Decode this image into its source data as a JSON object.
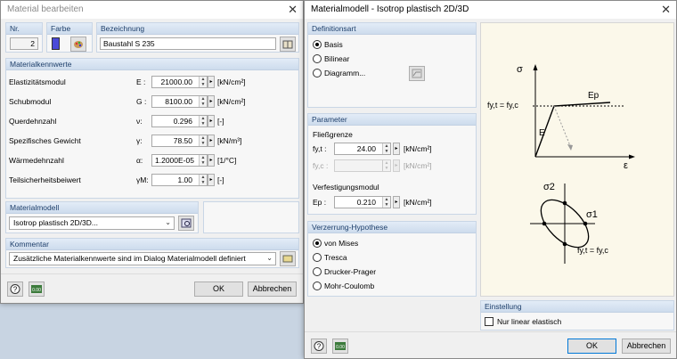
{
  "colors": {
    "farbe_swatch": "#4a4ad8",
    "group_header": "#cddced",
    "accent": "#0078d7"
  },
  "left": {
    "title": "Material bearbeiten",
    "nr_label": "Nr.",
    "nr_value": "2",
    "farbe_label": "Farbe",
    "bezeichnung_label": "Bezeichnung",
    "bezeichnung_value": "Baustahl S 235",
    "kennwerte_header": "Materialkennwerte",
    "rows": [
      {
        "label": "Elastizitätsmodul",
        "symbol": "E :",
        "value": "21000.00",
        "unit": "[kN/cm²]"
      },
      {
        "label": "Schubmodul",
        "symbol": "G :",
        "value": "8100.00",
        "unit": "[kN/cm²]"
      },
      {
        "label": "Querdehnzahl",
        "symbol": "ν:",
        "value": "0.296",
        "unit": "[-]"
      },
      {
        "label": "Spezifisches Gewicht",
        "symbol": "γ:",
        "value": "78.50",
        "unit": "[kN/m³]"
      },
      {
        "label": "Wärmedehnzahl",
        "symbol": "α:",
        "value": "1.2000E-05",
        "unit": "[1/°C]"
      },
      {
        "label": "Teilsicherheitsbeiwert",
        "symbol": "γM:",
        "value": "1.00",
        "unit": "[-]"
      }
    ],
    "modell_header": "Materialmodell",
    "modell_value": "Isotrop plastisch 2D/3D...",
    "kommentar_header": "Kommentar",
    "kommentar_value": "Zusätzliche Materialkennwerte sind im Dialog Materialmodell definiert",
    "ok": "OK",
    "cancel": "Abbrechen"
  },
  "right": {
    "title": "Materialmodell - Isotrop plastisch 2D/3D",
    "def_header": "Definitionsart",
    "def_options": [
      {
        "label": "Basis",
        "selected": true
      },
      {
        "label": "Bilinear",
        "selected": false
      },
      {
        "label": "Diagramm...",
        "selected": false
      }
    ],
    "param_header": "Parameter",
    "fliess_label": "Fließgrenze",
    "fyt_symbol": "fy,t :",
    "fyt_value": "24.00",
    "fyt_unit": "[kN/cm²]",
    "fyc_symbol": "fy,c :",
    "fyc_unit": "[kN/cm²]",
    "verf_label": "Verfestigungsmodul",
    "ep_symbol": "Ep :",
    "ep_value": "0.210",
    "ep_unit": "[kN/cm²]",
    "hyp_header": "Verzerrung-Hypothese",
    "hyp_options": [
      {
        "label": "von Mises",
        "selected": true
      },
      {
        "label": "Tresca",
        "selected": false
      },
      {
        "label": "Drucker-Prager",
        "selected": false
      },
      {
        "label": "Mohr-Coulomb",
        "selected": false
      }
    ],
    "einst_header": "Einstellung",
    "einst_check": "Nur linear elastisch",
    "diagram": {
      "sigma": "σ",
      "fy_eq": "fy,t = fy,c",
      "ep": "Ep",
      "e": "E",
      "eps": "ε",
      "sigma2": "σ2",
      "sigma1": "σ1",
      "fy_eq2": "fy,t = fy,c"
    },
    "ok": "OK",
    "cancel": "Abbrechen"
  }
}
